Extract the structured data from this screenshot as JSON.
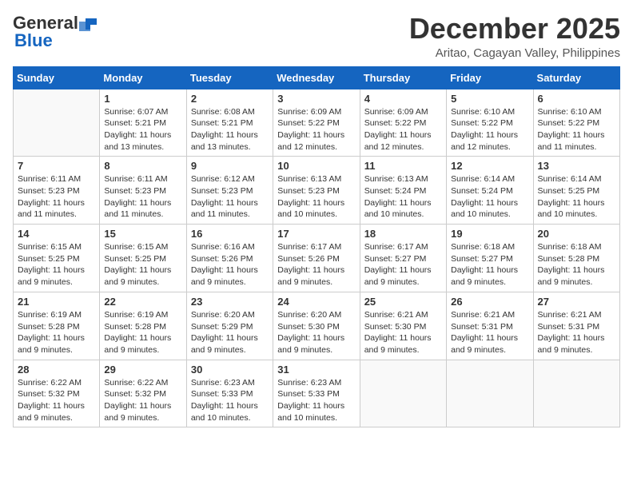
{
  "header": {
    "logo_general": "General",
    "logo_blue": "Blue",
    "month": "December 2025",
    "location": "Aritao, Cagayan Valley, Philippines"
  },
  "weekdays": [
    "Sunday",
    "Monday",
    "Tuesday",
    "Wednesday",
    "Thursday",
    "Friday",
    "Saturday"
  ],
  "weeks": [
    [
      {
        "day": "",
        "empty": true
      },
      {
        "day": "1",
        "sunrise": "Sunrise: 6:07 AM",
        "sunset": "Sunset: 5:21 PM",
        "daylight": "Daylight: 11 hours and 13 minutes."
      },
      {
        "day": "2",
        "sunrise": "Sunrise: 6:08 AM",
        "sunset": "Sunset: 5:21 PM",
        "daylight": "Daylight: 11 hours and 13 minutes."
      },
      {
        "day": "3",
        "sunrise": "Sunrise: 6:09 AM",
        "sunset": "Sunset: 5:22 PM",
        "daylight": "Daylight: 11 hours and 12 minutes."
      },
      {
        "day": "4",
        "sunrise": "Sunrise: 6:09 AM",
        "sunset": "Sunset: 5:22 PM",
        "daylight": "Daylight: 11 hours and 12 minutes."
      },
      {
        "day": "5",
        "sunrise": "Sunrise: 6:10 AM",
        "sunset": "Sunset: 5:22 PM",
        "daylight": "Daylight: 11 hours and 12 minutes."
      },
      {
        "day": "6",
        "sunrise": "Sunrise: 6:10 AM",
        "sunset": "Sunset: 5:22 PM",
        "daylight": "Daylight: 11 hours and 11 minutes."
      }
    ],
    [
      {
        "day": "7",
        "sunrise": "Sunrise: 6:11 AM",
        "sunset": "Sunset: 5:23 PM",
        "daylight": "Daylight: 11 hours and 11 minutes."
      },
      {
        "day": "8",
        "sunrise": "Sunrise: 6:11 AM",
        "sunset": "Sunset: 5:23 PM",
        "daylight": "Daylight: 11 hours and 11 minutes."
      },
      {
        "day": "9",
        "sunrise": "Sunrise: 6:12 AM",
        "sunset": "Sunset: 5:23 PM",
        "daylight": "Daylight: 11 hours and 11 minutes."
      },
      {
        "day": "10",
        "sunrise": "Sunrise: 6:13 AM",
        "sunset": "Sunset: 5:23 PM",
        "daylight": "Daylight: 11 hours and 10 minutes."
      },
      {
        "day": "11",
        "sunrise": "Sunrise: 6:13 AM",
        "sunset": "Sunset: 5:24 PM",
        "daylight": "Daylight: 11 hours and 10 minutes."
      },
      {
        "day": "12",
        "sunrise": "Sunrise: 6:14 AM",
        "sunset": "Sunset: 5:24 PM",
        "daylight": "Daylight: 11 hours and 10 minutes."
      },
      {
        "day": "13",
        "sunrise": "Sunrise: 6:14 AM",
        "sunset": "Sunset: 5:25 PM",
        "daylight": "Daylight: 11 hours and 10 minutes."
      }
    ],
    [
      {
        "day": "14",
        "sunrise": "Sunrise: 6:15 AM",
        "sunset": "Sunset: 5:25 PM",
        "daylight": "Daylight: 11 hours and 9 minutes."
      },
      {
        "day": "15",
        "sunrise": "Sunrise: 6:15 AM",
        "sunset": "Sunset: 5:25 PM",
        "daylight": "Daylight: 11 hours and 9 minutes."
      },
      {
        "day": "16",
        "sunrise": "Sunrise: 6:16 AM",
        "sunset": "Sunset: 5:26 PM",
        "daylight": "Daylight: 11 hours and 9 minutes."
      },
      {
        "day": "17",
        "sunrise": "Sunrise: 6:17 AM",
        "sunset": "Sunset: 5:26 PM",
        "daylight": "Daylight: 11 hours and 9 minutes."
      },
      {
        "day": "18",
        "sunrise": "Sunrise: 6:17 AM",
        "sunset": "Sunset: 5:27 PM",
        "daylight": "Daylight: 11 hours and 9 minutes."
      },
      {
        "day": "19",
        "sunrise": "Sunrise: 6:18 AM",
        "sunset": "Sunset: 5:27 PM",
        "daylight": "Daylight: 11 hours and 9 minutes."
      },
      {
        "day": "20",
        "sunrise": "Sunrise: 6:18 AM",
        "sunset": "Sunset: 5:28 PM",
        "daylight": "Daylight: 11 hours and 9 minutes."
      }
    ],
    [
      {
        "day": "21",
        "sunrise": "Sunrise: 6:19 AM",
        "sunset": "Sunset: 5:28 PM",
        "daylight": "Daylight: 11 hours and 9 minutes."
      },
      {
        "day": "22",
        "sunrise": "Sunrise: 6:19 AM",
        "sunset": "Sunset: 5:28 PM",
        "daylight": "Daylight: 11 hours and 9 minutes."
      },
      {
        "day": "23",
        "sunrise": "Sunrise: 6:20 AM",
        "sunset": "Sunset: 5:29 PM",
        "daylight": "Daylight: 11 hours and 9 minutes."
      },
      {
        "day": "24",
        "sunrise": "Sunrise: 6:20 AM",
        "sunset": "Sunset: 5:30 PM",
        "daylight": "Daylight: 11 hours and 9 minutes."
      },
      {
        "day": "25",
        "sunrise": "Sunrise: 6:21 AM",
        "sunset": "Sunset: 5:30 PM",
        "daylight": "Daylight: 11 hours and 9 minutes."
      },
      {
        "day": "26",
        "sunrise": "Sunrise: 6:21 AM",
        "sunset": "Sunset: 5:31 PM",
        "daylight": "Daylight: 11 hours and 9 minutes."
      },
      {
        "day": "27",
        "sunrise": "Sunrise: 6:21 AM",
        "sunset": "Sunset: 5:31 PM",
        "daylight": "Daylight: 11 hours and 9 minutes."
      }
    ],
    [
      {
        "day": "28",
        "sunrise": "Sunrise: 6:22 AM",
        "sunset": "Sunset: 5:32 PM",
        "daylight": "Daylight: 11 hours and 9 minutes."
      },
      {
        "day": "29",
        "sunrise": "Sunrise: 6:22 AM",
        "sunset": "Sunset: 5:32 PM",
        "daylight": "Daylight: 11 hours and 9 minutes."
      },
      {
        "day": "30",
        "sunrise": "Sunrise: 6:23 AM",
        "sunset": "Sunset: 5:33 PM",
        "daylight": "Daylight: 11 hours and 10 minutes."
      },
      {
        "day": "31",
        "sunrise": "Sunrise: 6:23 AM",
        "sunset": "Sunset: 5:33 PM",
        "daylight": "Daylight: 11 hours and 10 minutes."
      },
      {
        "day": "",
        "empty": true
      },
      {
        "day": "",
        "empty": true
      },
      {
        "day": "",
        "empty": true
      }
    ]
  ]
}
